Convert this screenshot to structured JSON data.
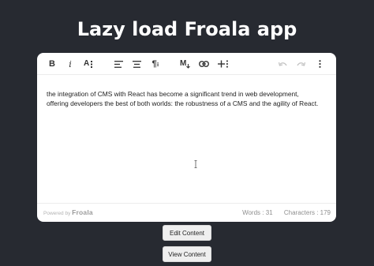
{
  "page": {
    "title": "Lazy load Froala app"
  },
  "editor": {
    "toolbar": {
      "bold": "B",
      "italic": "i",
      "font_size": "A",
      "markdown": "M",
      "icons": [
        "bold-icon",
        "italic-icon",
        "font-size-icon",
        "align-left-icon",
        "align-center-icon",
        "paragraph-format-icon",
        "markdown-icon",
        "insert-link-icon",
        "more-insert-icon",
        "undo-icon",
        "redo-icon",
        "more-options-icon"
      ]
    },
    "content": "the integration of CMS with React has become a significant trend in web development, offering developers the best of both worlds: the robustness of a CMS and the agility of React.",
    "footer": {
      "powered_by": "Powered by",
      "brand": "Froala",
      "words": "Words : 31",
      "characters": "Characters : 179"
    }
  },
  "buttons": {
    "edit": "Edit Content",
    "view": "View Content"
  },
  "colors": {
    "background": "#272a31",
    "editor": "#ffffff",
    "button": "#efefef"
  }
}
